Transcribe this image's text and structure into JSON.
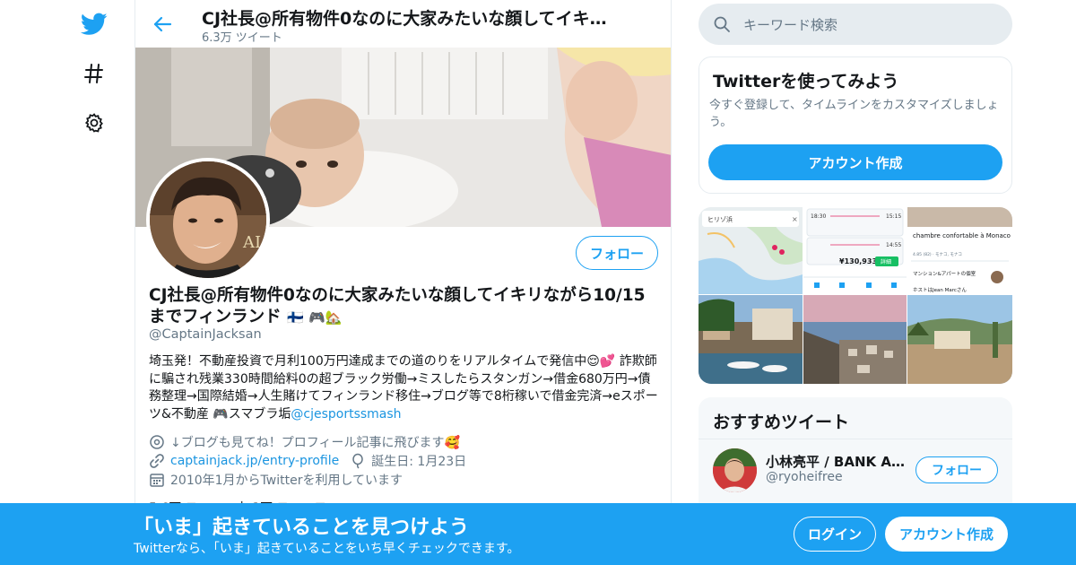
{
  "header": {
    "title": "CJ社長@所有物件0なのに大家みたいな顔してイキ…",
    "tweet_count": "6.3万 ツイート"
  },
  "profile": {
    "follow_label": "フォロー",
    "display_name": "CJ社長@所有物件0なのに大家みたいな顔してイキリながら10/15までフィンランド",
    "display_name_emoji": "🇫🇮 🎮🏡",
    "handle": "@CaptainJacksan",
    "bio_text": "埼玉発！不動産投資で月利100万円達成までの道のりをリアルタイムで発信中😌💕 詐欺師に騙され残業330時間給料0の超ブラック労働→ミスしたらスタンガン→借金680万円→債務整理→国際結婚→人生賭けてフィンランド移住→ブログ等で8桁稼いで借金完済→eスポーツ&不動産 🎮スマブラ垢",
    "bio_mention": "@cjesportssmash",
    "location": "↓ブログも見てね！プロフィール記事に飛びます🥰",
    "url": "captainjack.jp/entry-profile",
    "birthday": "誕生日: 1月23日",
    "joined": "2010年1月からTwitterを利用しています",
    "stats_partial": "5.6万 フォロー中   3万 フォロワー"
  },
  "sidebar": {
    "search_placeholder": "キーワード検索",
    "signup_title": "Twitterを使ってみよう",
    "signup_desc": "今すぐ登録して、タイムラインをカスタマイズしましょう。",
    "signup_button": "アカウント作成",
    "media": {
      "map_label": "ヒリゾ浜",
      "price": "¥130,933",
      "price_button": "詳細",
      "listing_title": "chambre confortable à Monaco",
      "listing_rating": "4.85 (82) · モナコ, モナコ",
      "listing_type": "マンション&アパートの個室",
      "listing_host": "ホストはJean Marcさん",
      "times": [
        "18:30",
        "15:15",
        "14:55"
      ]
    },
    "recommended_title": "おすすめツイート",
    "rec_user_name": "小林亮平 / BANK ACCEL…",
    "rec_user_handle": "@ryoheifree",
    "rec_follow": "フォロー"
  },
  "bottom_bar": {
    "title": "「いま」起きていることを見つけよう",
    "subtitle": "Twitterなら、「いま」起きていることをいち早くチェックできます。",
    "login": "ログイン",
    "signup": "アカウント作成"
  },
  "colors": {
    "accent": "#1da1f2",
    "link": "#1b95e0",
    "muted": "#657786",
    "border": "#e6ecf0"
  }
}
